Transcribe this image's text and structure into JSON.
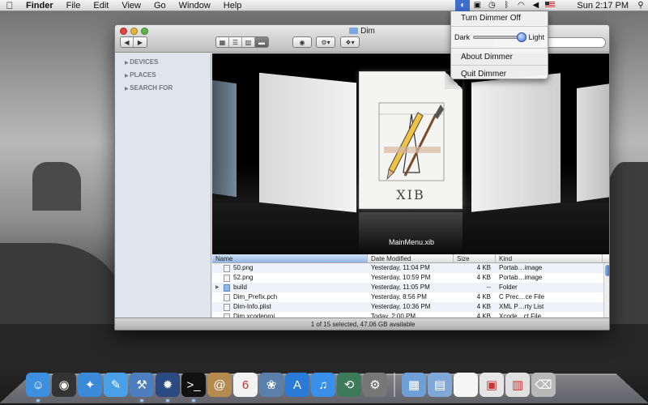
{
  "menubar": {
    "apple_icon": "apple-icon",
    "app_name": "Finder",
    "items": [
      "File",
      "Edit",
      "View",
      "Go",
      "Window",
      "Help"
    ],
    "clock": "Sun 2:17 PM",
    "status_icons": [
      "dimmer-icon",
      "display-icon",
      "timemachine-icon",
      "bluetooth-icon",
      "wifi-icon",
      "volume-icon",
      "flag-icon"
    ]
  },
  "dimmer_menu": {
    "turn_off": "Turn Dimmer Off",
    "dark_label": "Dark",
    "light_label": "Light",
    "level": 0.95,
    "about": "About Dimmer",
    "quit": "Quit Dimmer"
  },
  "window": {
    "title": "Dim",
    "view_modes": [
      "icon-view",
      "list-view",
      "column-view",
      "coverflow-view"
    ],
    "selected_view": 3,
    "sidebar": [
      "DEVICES",
      "PLACES",
      "SEARCH FOR"
    ],
    "coverflow": {
      "caption": "MainMenu.xib",
      "xib_text": "XIB"
    },
    "columns": [
      "Name",
      "Date Modified",
      "Size",
      "Kind"
    ],
    "files": [
      {
        "name": "50.png",
        "date": "Yesterday, 11:04 PM",
        "size": "4 KB",
        "kind": "Portab…image",
        "folder": false
      },
      {
        "name": "52.png",
        "date": "Yesterday, 10:59 PM",
        "size": "4 KB",
        "kind": "Portab…image",
        "folder": false
      },
      {
        "name": "build",
        "date": "Yesterday, 11:05 PM",
        "size": "--",
        "kind": "Folder",
        "folder": true
      },
      {
        "name": "Dim_Prefix.pch",
        "date": "Yesterday, 8:56 PM",
        "size": "4 KB",
        "kind": "C Prec…ce File",
        "folder": false
      },
      {
        "name": "Dim-Info.plist",
        "date": "Yesterday, 10:36 PM",
        "size": "4 KB",
        "kind": "XML P…rty List",
        "folder": false
      },
      {
        "name": "Dim.xcodeproj",
        "date": "Today, 2:00 PM",
        "size": "4 KB",
        "kind": "Xcode…ct File",
        "folder": false
      }
    ],
    "status": "1 of 15 selected, 47.06 GB available"
  },
  "dock": {
    "apps": [
      {
        "name": "finder-icon",
        "color": "#3d8fe0",
        "glyph": "☺"
      },
      {
        "name": "dashboard-icon",
        "color": "#333333",
        "glyph": "◉"
      },
      {
        "name": "safari-icon",
        "color": "#3a8ad8",
        "glyph": "✦"
      },
      {
        "name": "ichat-icon",
        "color": "#4aa0e6",
        "glyph": "✎"
      },
      {
        "name": "xcode-icon",
        "color": "#4d7fbf",
        "glyph": "⚒"
      },
      {
        "name": "interface-builder-icon",
        "color": "#2c4a82",
        "glyph": "✹"
      },
      {
        "name": "terminal-icon",
        "color": "#111111",
        "glyph": ">_"
      },
      {
        "name": "address-book-icon",
        "color": "#b48a4e",
        "glyph": "@"
      },
      {
        "name": "ical-icon",
        "color": "#f2f2f2",
        "glyph": "6"
      },
      {
        "name": "iphoto-icon",
        "color": "#5a7fa8",
        "glyph": "❀"
      },
      {
        "name": "app-store-icon",
        "color": "#2a7ad8",
        "glyph": "A"
      },
      {
        "name": "itunes-icon",
        "color": "#3a8fe8",
        "glyph": "♫"
      },
      {
        "name": "time-machine-icon",
        "color": "#3c7a5a",
        "glyph": "⟲"
      },
      {
        "name": "system-preferences-icon",
        "color": "#777777",
        "glyph": "⚙"
      }
    ],
    "stacks": [
      {
        "name": "applications-stack-icon",
        "color": "#6e9fd6",
        "glyph": "▦"
      },
      {
        "name": "documents-stack-icon",
        "color": "#7fa8d8",
        "glyph": "▤"
      },
      {
        "name": "document-icon",
        "color": "#f5f5f5",
        "glyph": " "
      },
      {
        "name": "downloads-stack-icon",
        "color": "#e6e6e6",
        "glyph": "▣"
      },
      {
        "name": "window-stack-icon",
        "color": "#e0e0e0",
        "glyph": "▥"
      },
      {
        "name": "trash-icon",
        "color": "#b8b8b8",
        "glyph": "⌫"
      }
    ]
  }
}
